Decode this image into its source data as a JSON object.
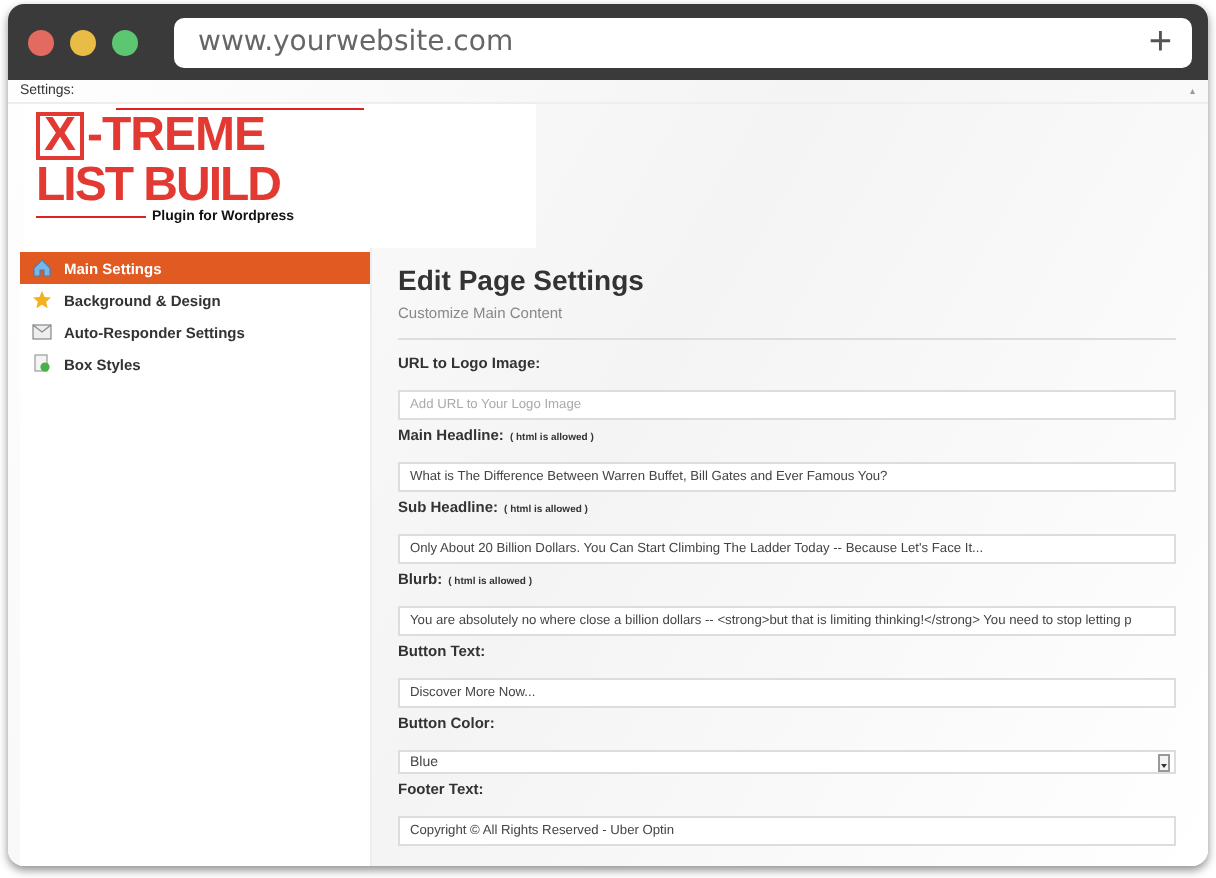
{
  "browser": {
    "url": "www.yourwebsite.com",
    "new_tab": "+"
  },
  "settings_bar": {
    "label": "Settings:",
    "marker": "▴"
  },
  "logo": {
    "boxed_letter": "X",
    "line_1": "-TREME",
    "line_2": "LIST BUILD",
    "tagline": "Plugin for Wordpress"
  },
  "sidebar": {
    "items": [
      {
        "label": "Main Settings",
        "selected": true
      },
      {
        "label": "Background & Design",
        "selected": false
      },
      {
        "label": "Auto-Responder Settings",
        "selected": false
      },
      {
        "label": "Box Styles",
        "selected": false
      }
    ]
  },
  "content": {
    "title": "Edit Page Settings",
    "subtitle": "Customize Main Content",
    "fields": [
      {
        "kind": "text",
        "label": "URL to Logo Image:",
        "placeholder": "Add URL to Your Logo Image"
      },
      {
        "kind": "text",
        "label": "Main Headline:",
        "note": "( html is allowed )",
        "value": "What is The Difference Between Warren Buffet, Bill Gates and Ever Famous You?"
      },
      {
        "kind": "text",
        "label": "Sub Headline:",
        "note": "( html is allowed )",
        "value": "Only About 20 Billion Dollars. You Can Start Climbing The Ladder Today -- Because Let's Face It..."
      },
      {
        "kind": "text",
        "label": "Blurb:",
        "note": "( html is allowed )",
        "value": "You are absolutely no where close a billion dollars -- <strong>but that is limiting thinking!</strong> You need to stop letting p"
      },
      {
        "kind": "text",
        "label": "Button Text:",
        "value": "Discover More Now..."
      },
      {
        "kind": "select",
        "label": "Button Color:",
        "value": "Blue"
      },
      {
        "kind": "text",
        "label": "Footer Text:",
        "value": "Copyright © All Rights Reserved - Uber Optin"
      }
    ]
  }
}
